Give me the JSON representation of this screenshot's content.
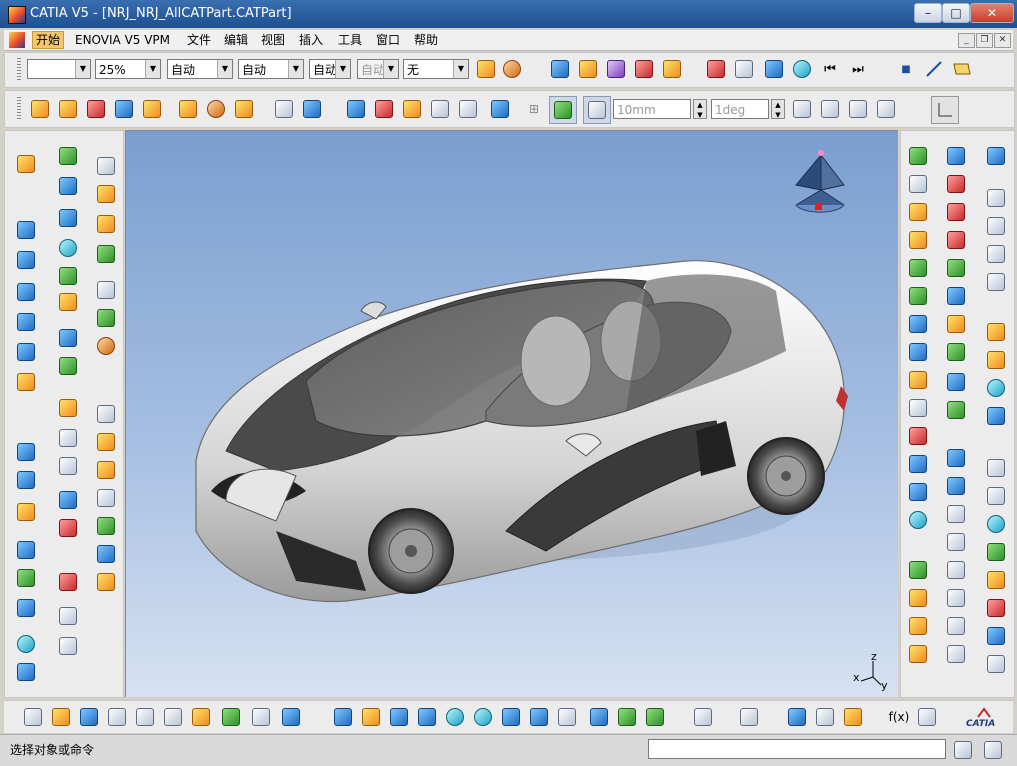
{
  "window": {
    "title": "CATIA V5 - [NRJ_NRJ_AllCATPart.CATPart]",
    "controls": {
      "minimize": "–",
      "maximize": "□",
      "close": "✕"
    }
  },
  "menubar": {
    "items": [
      "开始",
      "ENOVIA V5 VPM",
      "文件",
      "编辑",
      "视图",
      "插入",
      "工具",
      "窗口",
      "帮助"
    ],
    "active_index": 0,
    "mdi_controls": {
      "minimize": "_",
      "restore": "❐",
      "close": "✕"
    }
  },
  "toolbar_top": {
    "color_combo": "",
    "transparency_combo": "25%",
    "linetype_combo": "自动",
    "linewidth_combo": "自动",
    "pointtype_combo": "自动",
    "layer_combo_disabled": "自动",
    "layer_combo": "无"
  },
  "toolbar_second": {
    "step_field": {
      "value": "10mm"
    },
    "angle_field": {
      "value": "1deg"
    }
  },
  "compass": {
    "icon": "compass-icon"
  },
  "axis": {
    "x": "x",
    "y": "y",
    "z": "z"
  },
  "statusbar": {
    "message": "选择对象或命令",
    "command_input": ""
  },
  "colors": {
    "titlebar": "#1d4f91",
    "viewport_top": "#7b9ed0",
    "viewport_bottom": "#d6e2f2",
    "menu_active": "#f5c76c"
  },
  "branding": {
    "logo_text": "CATIA"
  }
}
